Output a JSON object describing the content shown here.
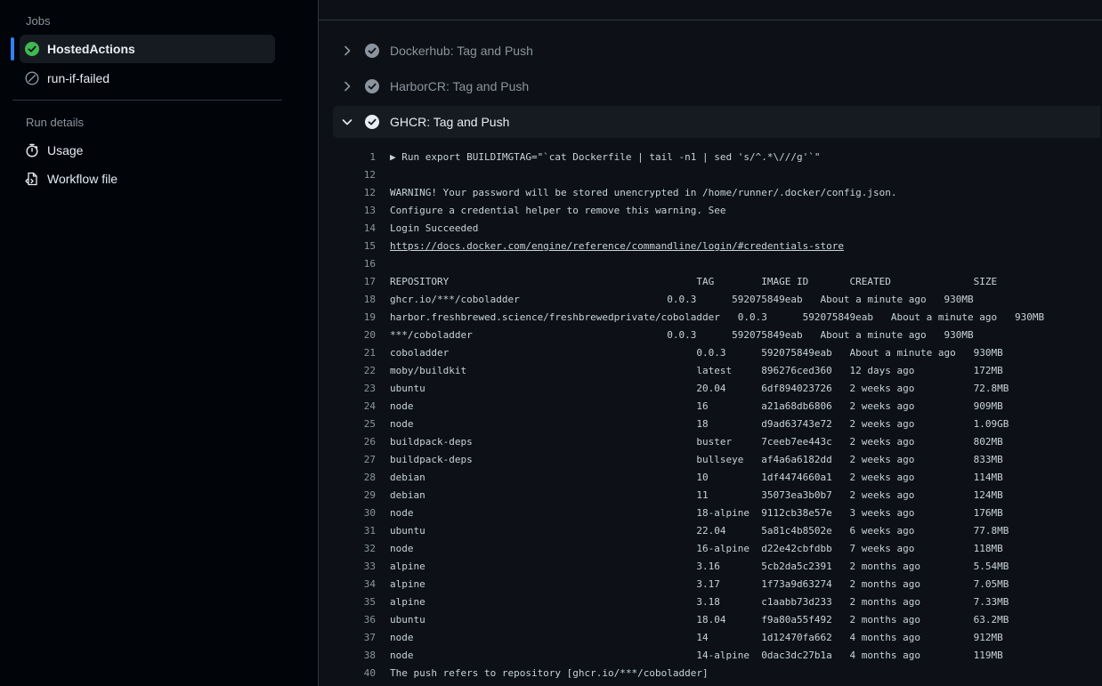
{
  "sidebar": {
    "jobs_label": "Jobs",
    "jobs": [
      {
        "label": "HostedActions",
        "status": "success",
        "active": true
      },
      {
        "label": "run-if-failed",
        "status": "skipped",
        "active": false
      }
    ],
    "run_details_label": "Run details",
    "details": [
      {
        "label": "Usage",
        "icon": "stopwatch-icon"
      },
      {
        "label": "Workflow file",
        "icon": "file-code-icon"
      }
    ]
  },
  "steps": [
    {
      "label": "Dockerhub: Tag and Push",
      "expanded": false
    },
    {
      "label": "HarborCR: Tag and Push",
      "expanded": false
    },
    {
      "label": "GHCR: Tag and Push",
      "expanded": true
    }
  ],
  "log": {
    "lines": [
      {
        "n": "1",
        "text": "▶ Run export BUILDIMGTAG=\"`cat Dockerfile | tail -n1 | sed 's/^.*\\///g'`\""
      },
      {
        "n": "12",
        "text": ""
      },
      {
        "n": "12",
        "text": "WARNING! Your password will be stored unencrypted in /home/runner/.docker/config.json."
      },
      {
        "n": "13",
        "text": "Configure a credential helper to remove this warning. See"
      },
      {
        "n": "14",
        "text": "Login Succeeded"
      },
      {
        "n": "15",
        "text": "https://docs.docker.com/engine/reference/commandline/login/#credentials-store",
        "link": true
      },
      {
        "n": "16",
        "text": ""
      },
      {
        "n": "17",
        "text": "REPOSITORY                                          TAG        IMAGE ID       CREATED              SIZE"
      },
      {
        "n": "18",
        "text": "ghcr.io/***/coboladder                         0.0.3      592075849eab   About a minute ago   930MB"
      },
      {
        "n": "19",
        "text": "harbor.freshbrewed.science/freshbrewedprivate/coboladder   0.0.3      592075849eab   About a minute ago   930MB"
      },
      {
        "n": "20",
        "text": "***/coboladder                                 0.0.3      592075849eab   About a minute ago   930MB"
      },
      {
        "n": "21",
        "text": "coboladder                                          0.0.3      592075849eab   About a minute ago   930MB"
      },
      {
        "n": "22",
        "text": "moby/buildkit                                       latest     896276ced360   12 days ago          172MB"
      },
      {
        "n": "23",
        "text": "ubuntu                                              20.04      6df894023726   2 weeks ago          72.8MB"
      },
      {
        "n": "24",
        "text": "node                                                16         a21a68db6806   2 weeks ago          909MB"
      },
      {
        "n": "25",
        "text": "node                                                18         d9ad63743e72   2 weeks ago          1.09GB"
      },
      {
        "n": "26",
        "text": "buildpack-deps                                      buster     7ceeb7ee443c   2 weeks ago          802MB"
      },
      {
        "n": "27",
        "text": "buildpack-deps                                      bullseye   af4a6a6182dd   2 weeks ago          833MB"
      },
      {
        "n": "28",
        "text": "debian                                              10         1df4474660a1   2 weeks ago          114MB"
      },
      {
        "n": "29",
        "text": "debian                                              11         35073ea3b0b7   2 weeks ago          124MB"
      },
      {
        "n": "30",
        "text": "node                                                18-alpine  9112cb38e57e   3 weeks ago          176MB"
      },
      {
        "n": "31",
        "text": "ubuntu                                              22.04      5a81c4b8502e   6 weeks ago          77.8MB"
      },
      {
        "n": "32",
        "text": "node                                                16-alpine  d22e42cbfdbb   7 weeks ago          118MB"
      },
      {
        "n": "33",
        "text": "alpine                                              3.16       5cb2da5c2391   2 months ago         5.54MB"
      },
      {
        "n": "34",
        "text": "alpine                                              3.17       1f73a9d63274   2 months ago         7.05MB"
      },
      {
        "n": "35",
        "text": "alpine                                              3.18       c1aabb73d233   2 months ago         7.33MB"
      },
      {
        "n": "36",
        "text": "ubuntu                                              18.04      f9a80a55f492   2 months ago         63.2MB"
      },
      {
        "n": "37",
        "text": "node                                                14         1d12470fa662   4 months ago         912MB"
      },
      {
        "n": "38",
        "text": "node                                                14-alpine  0dac3dc27b1a   4 months ago         119MB"
      },
      {
        "n": "40",
        "text": "The push refers to repository [ghcr.io/***/coboladder]"
      }
    ]
  },
  "colors": {
    "success": "#3fb950",
    "muted": "#8b949e",
    "accent": "#2f81f7"
  }
}
